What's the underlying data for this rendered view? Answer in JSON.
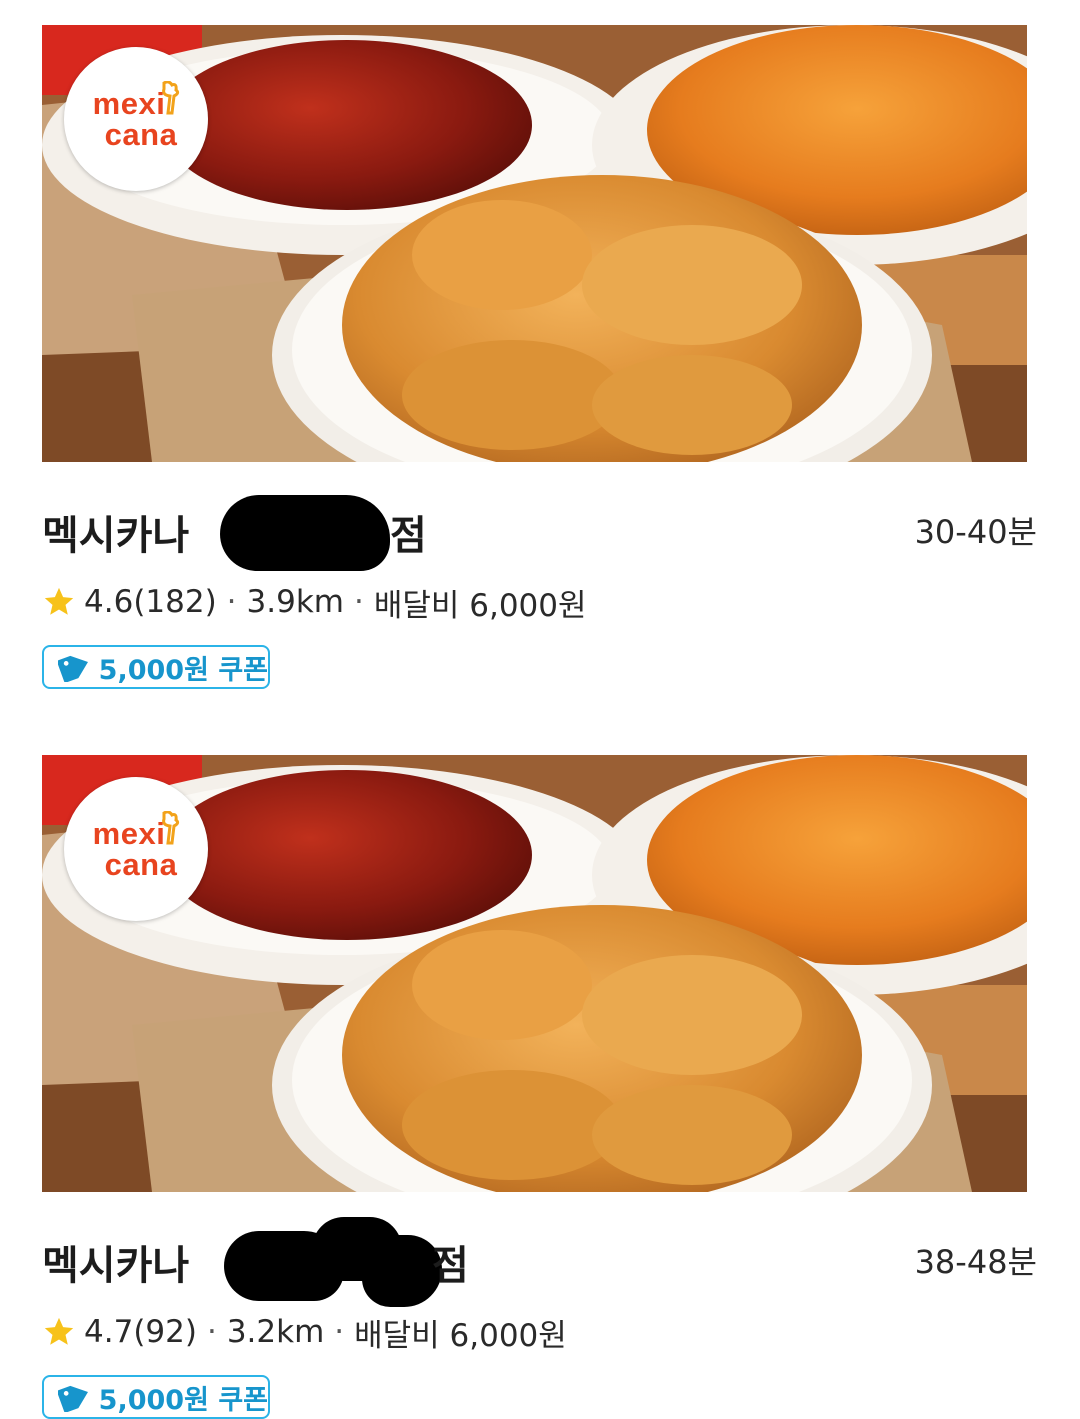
{
  "accent_color": "#1795cc",
  "star_color": "#f7c21a",
  "logo": {
    "line1": "mexi",
    "line2": "cana"
  },
  "stores": [
    {
      "name_prefix": "멕시카나",
      "name_suffix": "점",
      "delivery_time": "30-40분",
      "rating": "4.6",
      "review_count": "(182)",
      "distance": "3.9km",
      "delivery_fee": "배달비 6,000원",
      "coupon": "5,000원 쿠폰"
    },
    {
      "name_prefix": "멕시카나",
      "name_suffix": "점",
      "delivery_time": "38-48분",
      "rating": "4.7",
      "review_count": "(92)",
      "distance": "3.2km",
      "delivery_fee": "배달비 6,000원",
      "coupon": "5,000원 쿠폰"
    }
  ],
  "separator": "·"
}
